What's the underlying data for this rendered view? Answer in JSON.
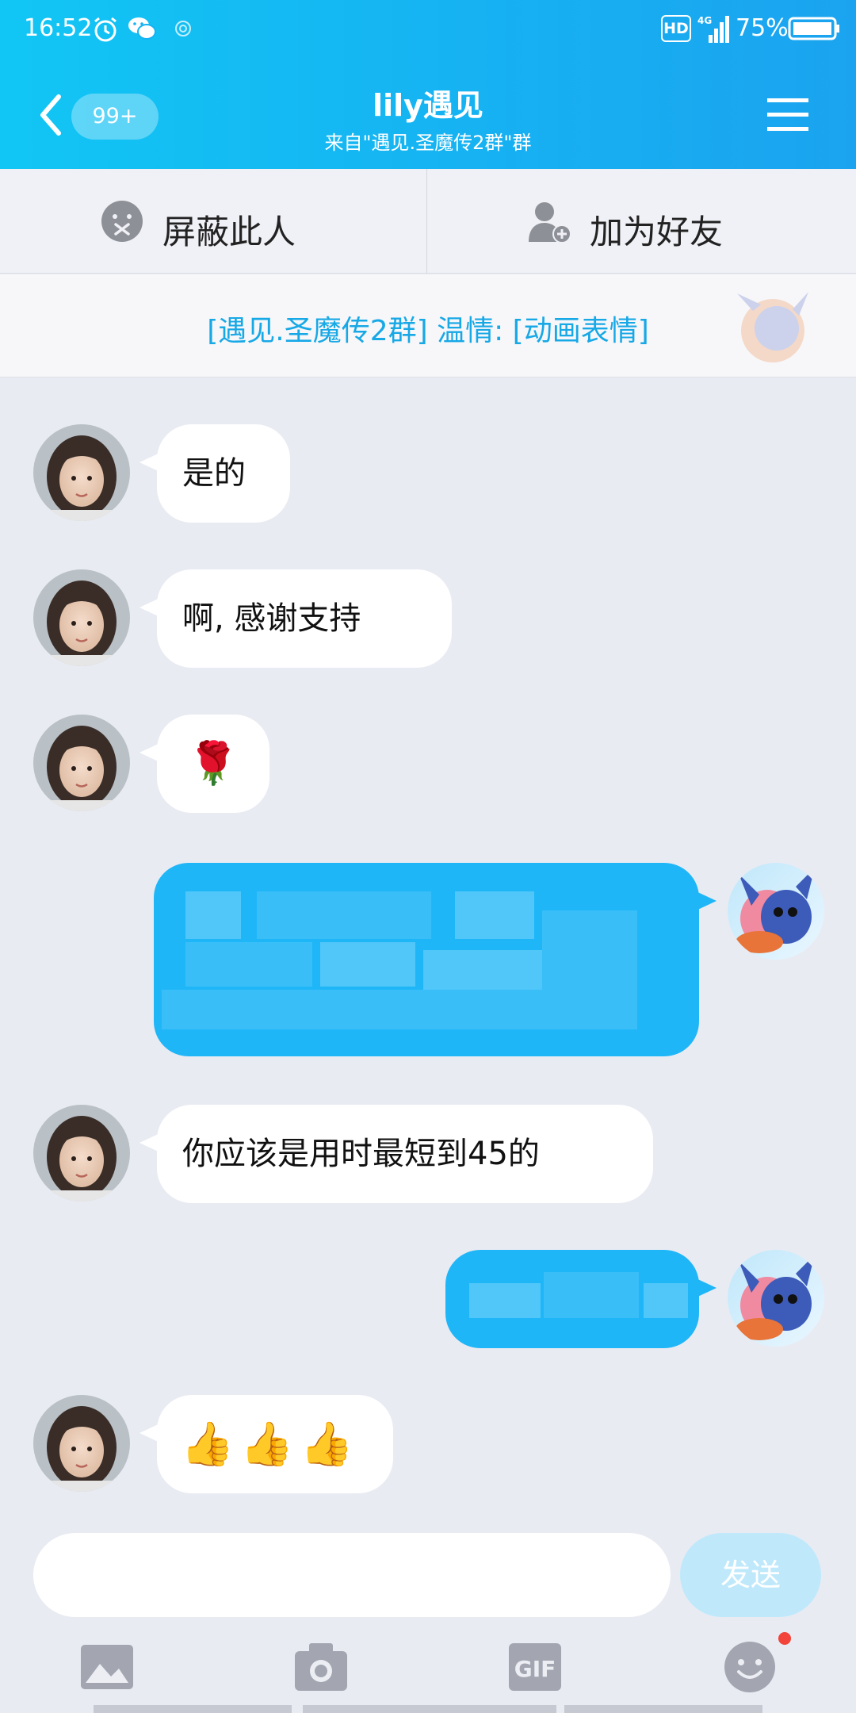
{
  "status_bar": {
    "time": "16:52",
    "network_badge": "HD",
    "network_type": "4G",
    "battery_percent": "75%",
    "icons": [
      "alarm-icon",
      "wechat-icon",
      "signal-icon",
      "battery-icon"
    ]
  },
  "header": {
    "unread_count": "99+",
    "title": "lily遇见",
    "subtitle": "来自\"遇见.圣魔传2群\"群",
    "icons": [
      "back-chevron-icon",
      "menu-icon"
    ]
  },
  "actions": {
    "block_label": "屏蔽此人",
    "add_friend_label": "加为好友",
    "icons": [
      "block-face-icon",
      "add-friend-icon"
    ]
  },
  "banner": {
    "text": "[遇见.圣魔传2群] 温情: [动画表情]"
  },
  "messages": [
    {
      "direction": "in",
      "text": "是的"
    },
    {
      "direction": "in",
      "text": "啊, 感谢支持"
    },
    {
      "direction": "in",
      "text": "🌹"
    },
    {
      "direction": "out",
      "text": "",
      "note": "pixelated"
    },
    {
      "direction": "in",
      "text": "你应该是用时最短到45的"
    },
    {
      "direction": "out",
      "text": "",
      "note": "pixelated"
    },
    {
      "direction": "in",
      "text": "👍👍👍"
    }
  ],
  "composer": {
    "input_value": "",
    "send_label": "发送"
  },
  "toolbar": {
    "gif_label": "GIF",
    "icons": [
      "image-icon",
      "camera-icon",
      "gif-icon",
      "emoji-icon"
    ]
  },
  "colors": {
    "header_gradient_start": "#11c6f4",
    "header_gradient_end": "#1ba3ef",
    "outgoing_bubble": "#1fb6f8",
    "background": "#e9ebf3",
    "banner_text": "#17a8e6",
    "send_button_disabled": "#bfe9fb",
    "notify_dot": "#f2443a"
  }
}
